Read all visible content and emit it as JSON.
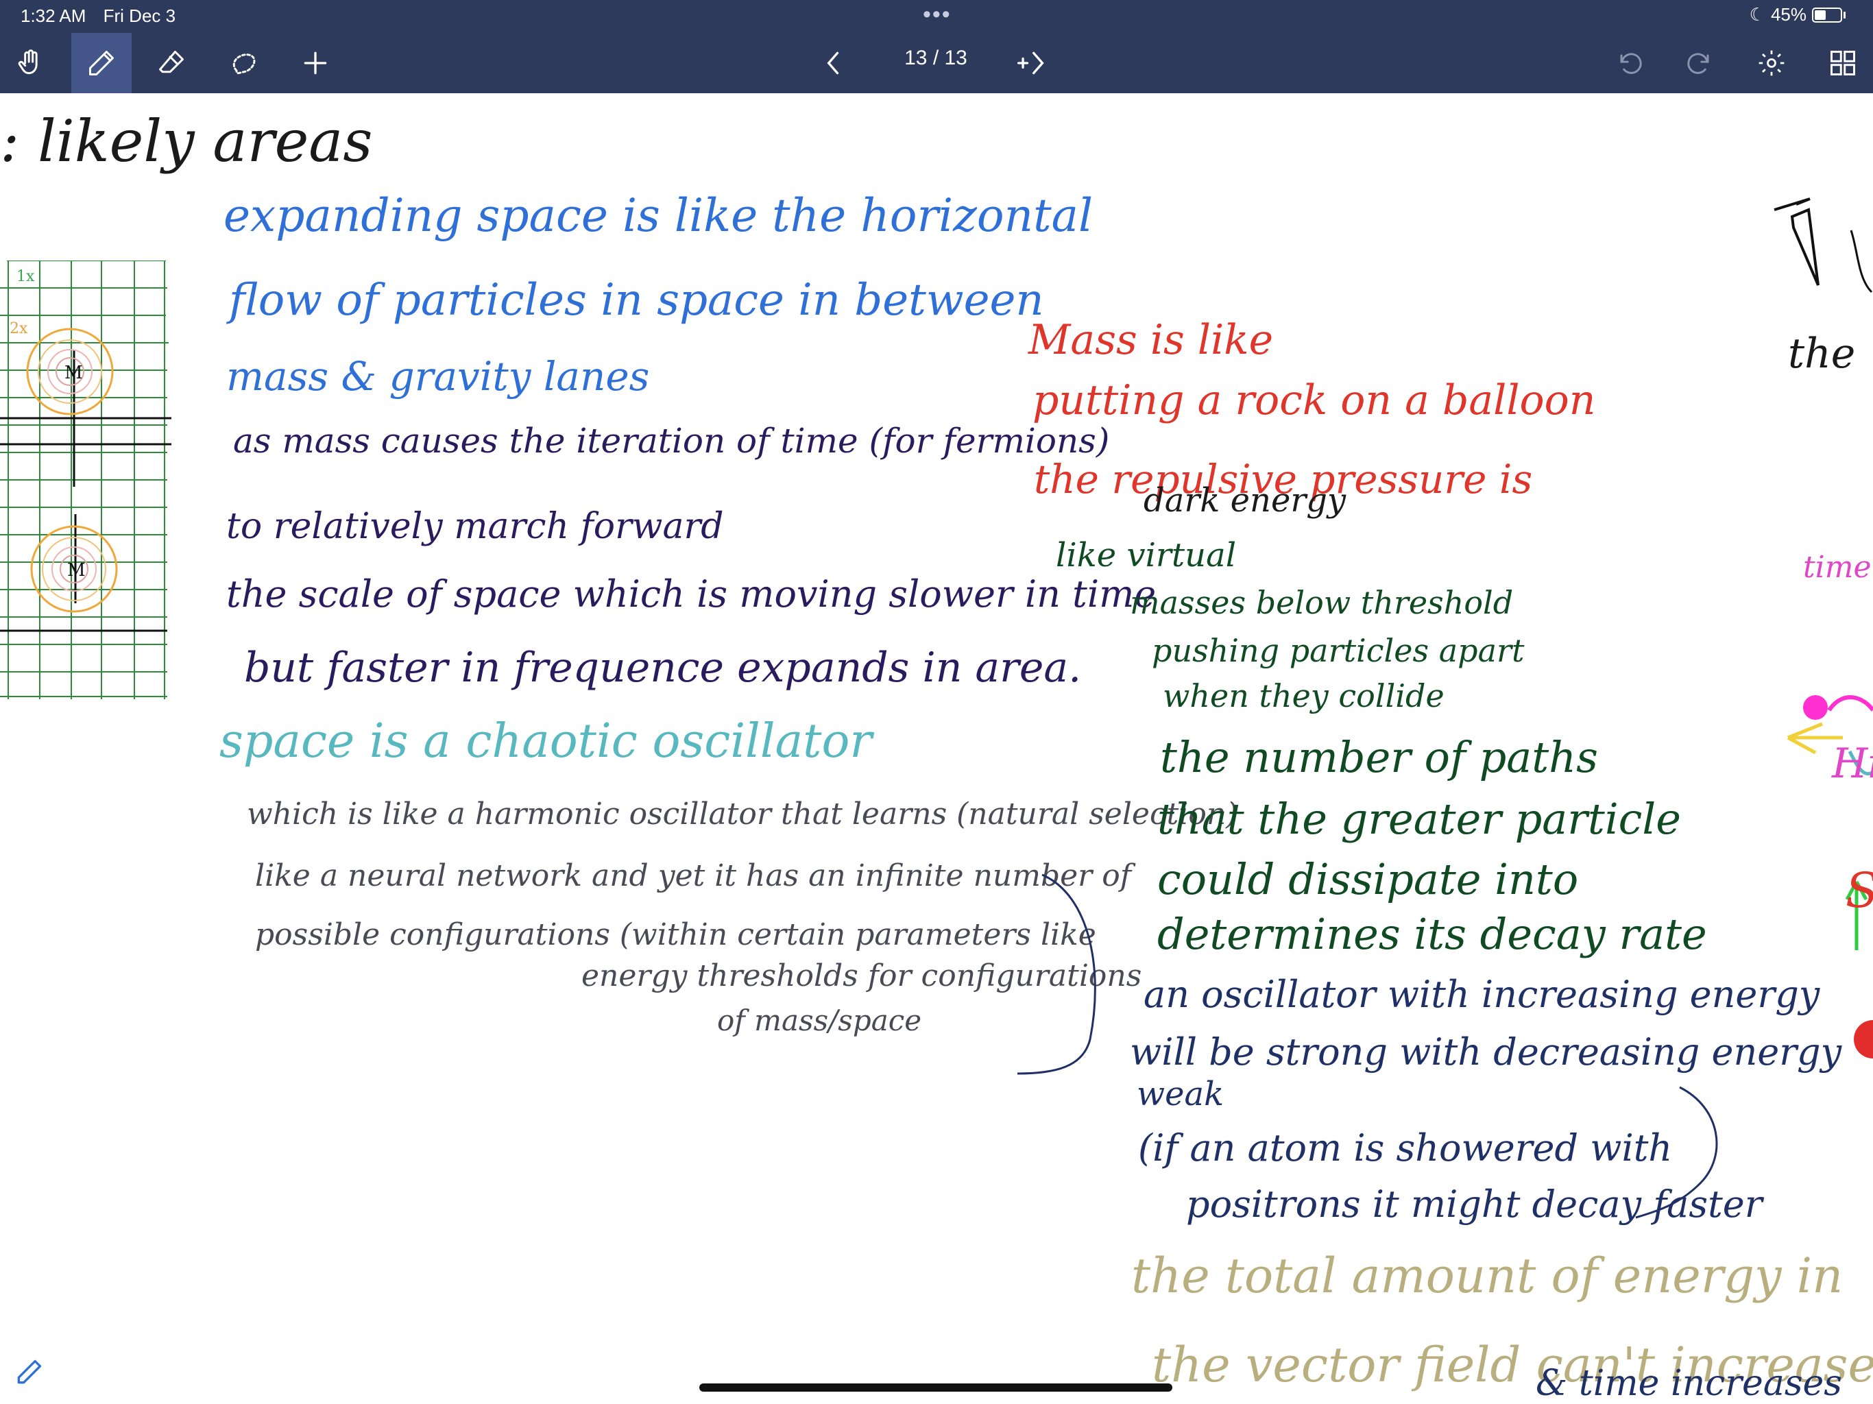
{
  "status_bar": {
    "time": "1:32 AM",
    "date": "Fri Dec 3",
    "battery": "45%",
    "battery_level": 0.45,
    "icons": [
      "multitask-dots-icon",
      "moon-icon",
      "battery-icon"
    ]
  },
  "toolbar": {
    "tools": [
      {
        "name": "hand-tool",
        "icon": "hand-icon",
        "active": false
      },
      {
        "name": "pen-tool",
        "icon": "pen-icon",
        "active": true
      },
      {
        "name": "eraser-tool",
        "icon": "eraser-icon",
        "active": false
      },
      {
        "name": "lasso-tool",
        "icon": "lasso-icon",
        "active": false
      },
      {
        "name": "add-tool",
        "icon": "plus-icon",
        "active": false
      }
    ],
    "page_indicator": "13 / 13",
    "right_tools": [
      "undo-icon",
      "redo-icon",
      "gear-icon",
      "grid-icon"
    ],
    "colors": {
      "bar": "#2d3a5c",
      "active_tool": "#44558a"
    }
  },
  "notes": {
    "heading": ": likely areas",
    "blue": [
      "expanding space is like the horizontal",
      "flow of particles in space in between",
      "mass & gravity lanes"
    ],
    "purple": [
      "as mass causes the iteration of time (for fermions)",
      "to relatively march forward",
      "the scale of space which is moving slower in time",
      "but faster in frequence expands in area."
    ],
    "teal": "space is a chaotic oscillator",
    "gray": [
      "which is like a harmonic oscillator that learns (natural selection)",
      "like a neural network and yet it has an infinite number of",
      "possible configurations (within certain parameters like",
      "energy thresholds for configurations",
      "of mass/space"
    ],
    "red": [
      "Mass is like",
      "putting a rock on a balloon",
      "the repulsive pressure is"
    ],
    "dark": "dark energy",
    "green": [
      "like virtual",
      "masses below threshold",
      "pushing particles apart",
      "when they collide",
      "the number of paths",
      "that the greater particle",
      "could dissipate into",
      "determines its decay rate"
    ],
    "navy": [
      "an oscillator with increasing energy",
      "will be strong with decreasing energy",
      "weak",
      "(if an atom is showered with",
      "positrons it might decay faster"
    ],
    "khaki": [
      "the total amount of energy in",
      "the vector field can't increase",
      "& time increases"
    ],
    "right_edge": [
      "the",
      "time",
      "Hi",
      "S"
    ],
    "grid_labels": [
      "M",
      "M",
      "1x",
      "2x"
    ],
    "ink_colors": {
      "black": "#1a1a1a",
      "blue": "#2f6fd8",
      "purple": "#2a1a5e",
      "teal": "#58b8c0",
      "gray": "#4a4a55",
      "red": "#e0352b",
      "green": "#0f4a22",
      "navy": "#1f3066",
      "khaki": "#b9ae7e"
    }
  }
}
